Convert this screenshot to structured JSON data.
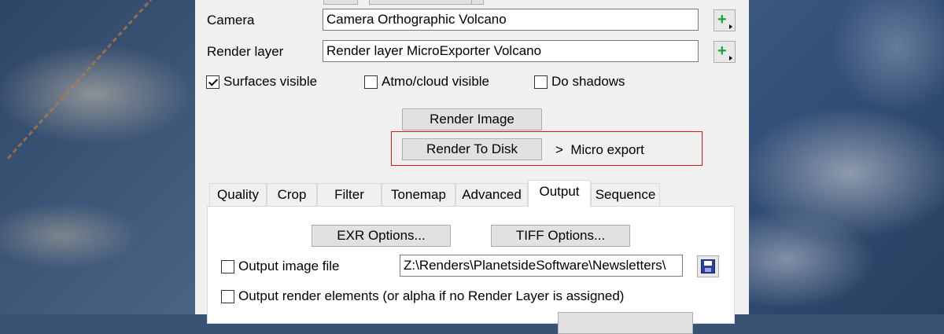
{
  "camera": {
    "label": "Camera",
    "value": "Camera Orthographic Volcano"
  },
  "render_layer": {
    "label": "Render layer",
    "value": "Render layer MicroExporter Volcano"
  },
  "visibility": {
    "surfaces": {
      "label": "Surfaces visible",
      "checked": true
    },
    "atmo": {
      "label": "Atmo/cloud visible",
      "checked": false
    },
    "shadows": {
      "label": "Do shadows",
      "checked": false
    }
  },
  "actions": {
    "render_image": "Render Image",
    "render_to_disk": "Render To Disk",
    "micro_export": ">  Micro export"
  },
  "tabs": [
    "Quality",
    "Crop",
    "Filter",
    "Tonemap",
    "Advanced",
    "Output",
    "Sequence"
  ],
  "active_tab": "Output",
  "output": {
    "exr_options": "EXR Options...",
    "tiff_options": "TIFF Options...",
    "output_image_file": {
      "label": "Output image file",
      "checked": false
    },
    "output_path": "Z:\\Renders\\PlanetsideSoftware\\Newsletters\\",
    "output_render_elements": {
      "label": "Output render elements (or alpha if no Render Layer is assigned)",
      "checked": false
    }
  },
  "colors": {
    "highlight_box": "#e0121a",
    "add_icon": "#1aa43a",
    "save_icon": "#2b3f9f"
  }
}
